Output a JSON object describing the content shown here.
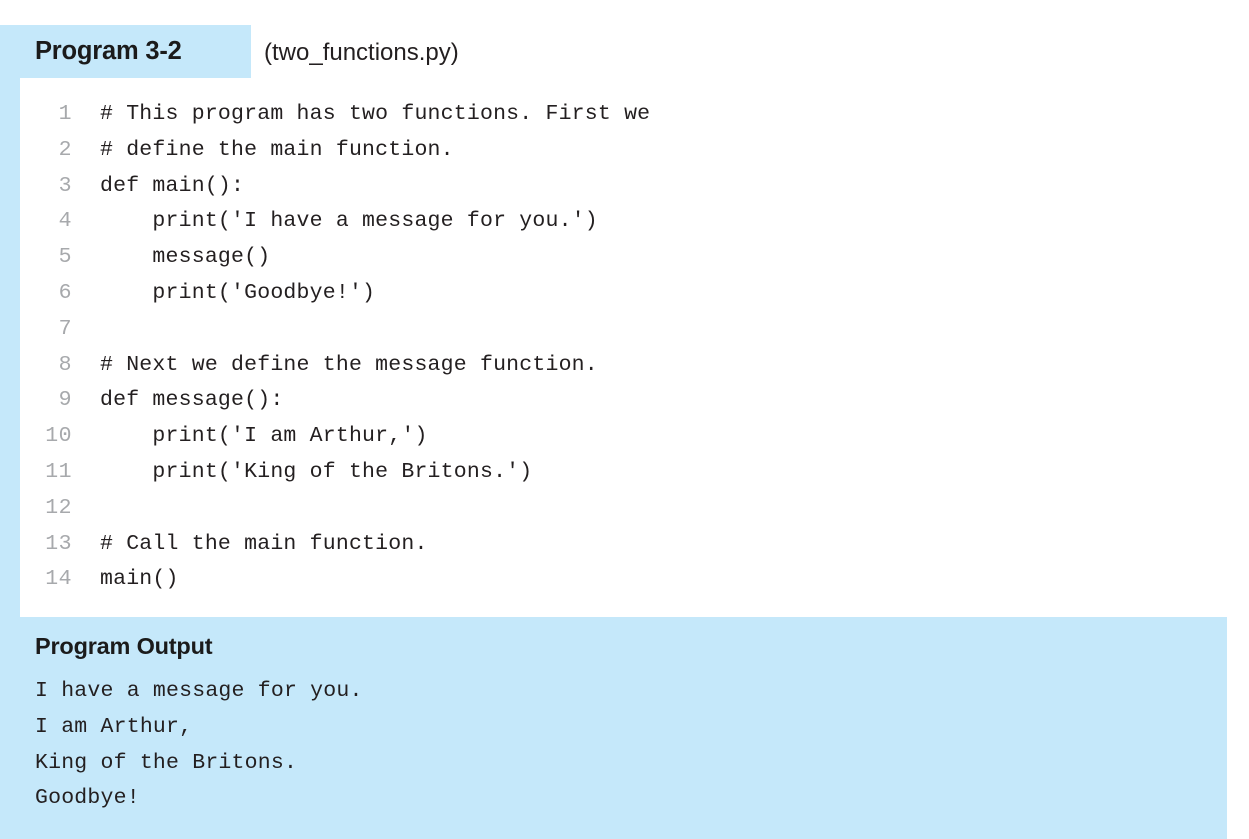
{
  "colors": {
    "accent_blue": "#c5e8fa",
    "text_dark": "#231f20",
    "line_number_gray": "#a7a9ac",
    "page_background": "#ffffff"
  },
  "header": {
    "badge_label": "Program 3-2",
    "filename": "(two_functions.py)"
  },
  "code": {
    "language": "python",
    "lines": [
      {
        "number": "1",
        "text": "# This program has two functions. First we"
      },
      {
        "number": "2",
        "text": "# define the main function."
      },
      {
        "number": "3",
        "text": "def main():"
      },
      {
        "number": "4",
        "text": "    print('I have a message for you.')"
      },
      {
        "number": "5",
        "text": "    message()"
      },
      {
        "number": "6",
        "text": "    print('Goodbye!')"
      },
      {
        "number": "7",
        "text": ""
      },
      {
        "number": "8",
        "text": "# Next we define the message function."
      },
      {
        "number": "9",
        "text": "def message():"
      },
      {
        "number": "10",
        "text": "    print('I am Arthur,')"
      },
      {
        "number": "11",
        "text": "    print('King of the Britons.')"
      },
      {
        "number": "12",
        "text": ""
      },
      {
        "number": "13",
        "text": "# Call the main function."
      },
      {
        "number": "14",
        "text": "main()"
      }
    ]
  },
  "output": {
    "title": "Program Output",
    "lines": [
      "I have a message for you.",
      "I am Arthur,",
      "King of the Britons.",
      "Goodbye!"
    ]
  }
}
